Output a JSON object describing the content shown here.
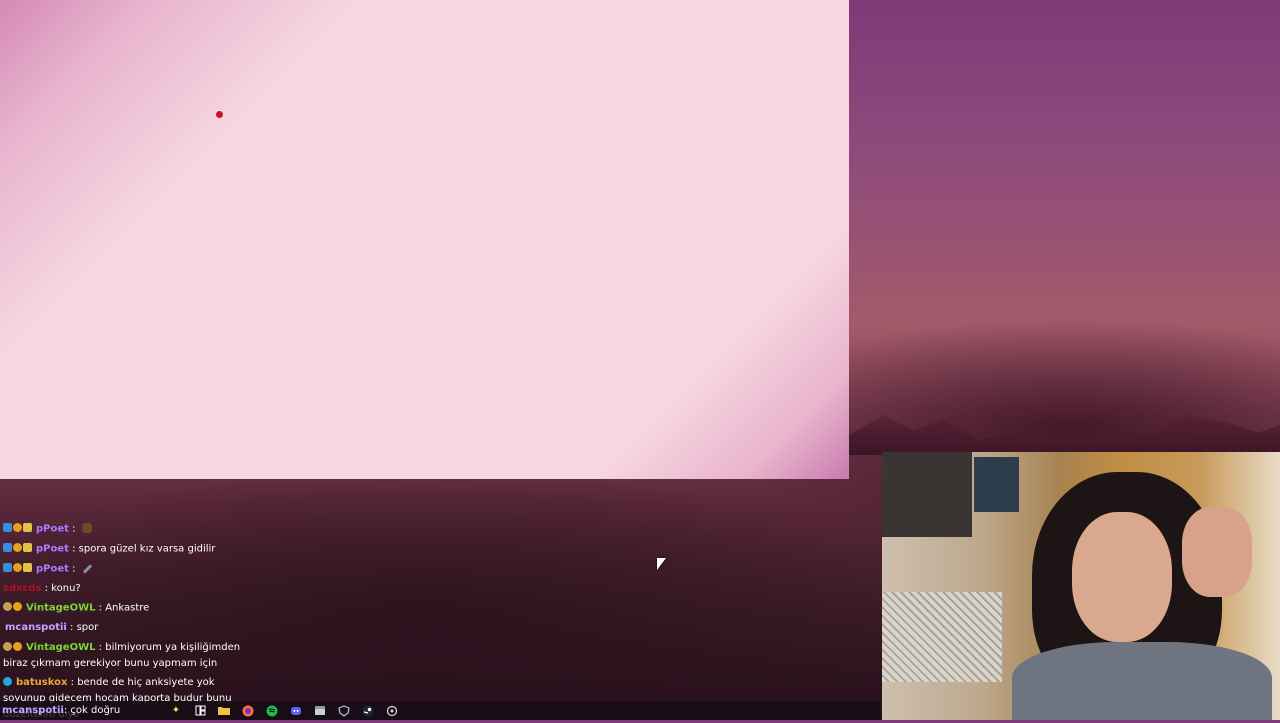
{
  "chat": {
    "messages": [
      {
        "user": "pPoet",
        "sep": " : ",
        "text": "",
        "user_color": "#a97cff",
        "badges": [
          "blue",
          "gold",
          "crown"
        ],
        "emote": "hat-emote"
      },
      {
        "user": "pPoet",
        "sep": " : ",
        "text": "spora güzel kız varsa gidilir",
        "user_color": "#a97cff",
        "badges": [
          "blue",
          "gold",
          "crown"
        ]
      },
      {
        "user": "pPoet",
        "sep": " : ",
        "text": "",
        "user_color": "#a97cff",
        "badges": [
          "blue",
          "gold",
          "crown"
        ],
        "emote": "pen-emote"
      },
      {
        "user": "zdxcds",
        "sep": " : ",
        "text": "konu?",
        "user_color": "#b1102a",
        "badges": []
      },
      {
        "user": "VintageOWL",
        "sep": " : ",
        "text": "Ankastre",
        "user_color": "#7cd43a",
        "badges": [
          "bits",
          "gold"
        ]
      },
      {
        "user": "mcanspotii",
        "sep": " : ",
        "text": "spor",
        "user_color": "#c9a2ff",
        "badges": []
      },
      {
        "user": "VintageOWL",
        "sep": " : ",
        "text": "bilmiyorum ya kişiliğimden biraz çıkmam gerekiyor bunu yapmam için",
        "user_color": "#7cd43a",
        "badges": [
          "bits",
          "gold"
        ]
      },
      {
        "user": "batuskox",
        "sep": " : ",
        "text": "bende de hiç anksiyete yok soyunup gidecem hocam kaporta budur bunu düzeltelim diye",
        "user_color": "#e8a63a",
        "badges": [
          "cyan"
        ]
      }
    ]
  },
  "taskbar": {
    "input_user": "mcanspotii",
    "input_text": ": çok doğru",
    "icons": [
      "sparkle-icon",
      "task-view-icon",
      "file-explorer-icon",
      "firefox-icon",
      "spotify-icon",
      "discord-icon",
      "files-icon",
      "vpn-icon",
      "steam-icon",
      "settings-icon"
    ]
  },
  "colors": {
    "browser_bg": "#f7d8e1",
    "cursor_dot": "#c8102e"
  }
}
